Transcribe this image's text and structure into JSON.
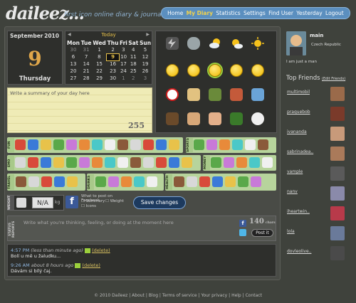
{
  "brand": {
    "logo": "daileez...",
    "tagline": "first icon online diary & journal"
  },
  "nav": [
    "Home",
    "My Diary",
    "Statistics",
    "Settings",
    "Find User",
    "Yesterday",
    "Logout"
  ],
  "nav_active": "My Diary",
  "date": {
    "month": "September",
    "year": "2010",
    "day": "9",
    "weekday": "Thursday"
  },
  "calendar": {
    "today_label": "Today",
    "headers": [
      "Mon",
      "Tue",
      "Wed",
      "Thu",
      "Fri",
      "Sat",
      "Sun"
    ],
    "rows": [
      [
        "30",
        "31",
        "1",
        "2",
        "3",
        "4",
        "5"
      ],
      [
        "6",
        "7",
        "8",
        "9",
        "10",
        "11",
        "12"
      ],
      [
        "13",
        "14",
        "15",
        "16",
        "17",
        "18",
        "19"
      ],
      [
        "20",
        "21",
        "22",
        "23",
        "24",
        "25",
        "26"
      ],
      [
        "27",
        "28",
        "29",
        "30",
        "1",
        "2",
        "3"
      ]
    ],
    "selected": "9"
  },
  "summary": {
    "placeholder": "Write a summary of your day here",
    "counter": "255"
  },
  "categories": {
    "fun": "FUN",
    "sports": "SPORTS",
    "emo": "EMO",
    "money": "MONEY",
    "travel": "TRAVEL",
    "drinks": "DRINKS",
    "health": "HEALTH",
    "weight": "WEIGHT"
  },
  "weight": {
    "value": "N/A",
    "unit": "kg"
  },
  "facebook": {
    "title": "What to post on Facebook",
    "opt_summary": "Summary",
    "opt_weight": "Weight",
    "opt_icons": "Icons"
  },
  "save_label": "Save changes",
  "status": {
    "label": "STATUS REPORTS",
    "placeholder": "Write what you're thinking, feeling, or doing at the moment here",
    "counter": "140",
    "counter_unit": "chars",
    "post_label": "Post it"
  },
  "feed": [
    {
      "time": "4:57 PM",
      "when": "(less than minute ago)",
      "text": "Bolí u mě u žaludku...",
      "action": "(delete)"
    },
    {
      "time": "9:26 AM",
      "when": "about 8 hours ago",
      "text": "Dávám si bílý čaj.",
      "action": "(delete)"
    }
  ],
  "profile": {
    "name": "main",
    "location": "Czech Republic",
    "bio": "I am just a man"
  },
  "friends": {
    "title": "Top Friends",
    "edit": "(Edit Friends)",
    "list": [
      "multimobil",
      "praquebob",
      "ivananda",
      "sabrinadea..",
      "vample",
      "nanv",
      "iheartwin..",
      "lola",
      "dovleolive.."
    ]
  },
  "footer": [
    "© 2010 Daileez",
    "About",
    "Blog",
    "Terms of service",
    "Your privacy",
    "Help",
    "Contact"
  ]
}
